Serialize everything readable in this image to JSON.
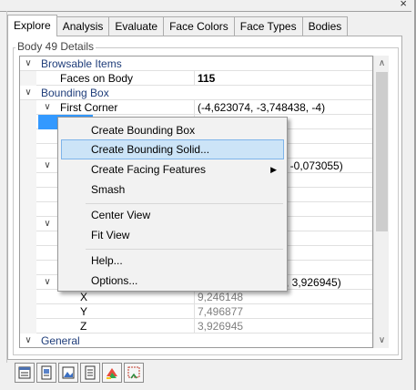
{
  "window": {
    "close_glyph": "×"
  },
  "tabs": [
    {
      "label": "Explore",
      "active": true
    },
    {
      "label": "Analysis"
    },
    {
      "label": "Evaluate"
    },
    {
      "label": "Face Colors"
    },
    {
      "label": "Face Types"
    },
    {
      "label": "Bodies"
    }
  ],
  "group": {
    "title": "Body 49 Details"
  },
  "grid": {
    "rows": {
      "browsable": {
        "label": "Browsable Items"
      },
      "faces": {
        "label": "Faces on Body",
        "value": "115"
      },
      "bbox": {
        "label": "Bounding Box"
      },
      "first_corner": {
        "label": "First Corner",
        "value": "(-4,623074, -3,748438, -4)"
      },
      "partial1": {
        "value": ", -0,073055)"
      },
      "partial2": {
        "value": ", 3,926945)"
      },
      "x": {
        "label": "X",
        "value": "9,246148"
      },
      "y": {
        "label": "Y",
        "value": "7,496877"
      },
      "z": {
        "label": "Z",
        "value": "3,926945"
      },
      "general": {
        "label": "General"
      }
    }
  },
  "context_menu": {
    "items": [
      {
        "label": "Create Bounding Box"
      },
      {
        "label": "Create Bounding Solid...",
        "highlighted": true
      },
      {
        "label": "Create Facing Features",
        "submenu": true
      },
      {
        "label": "Smash"
      },
      {
        "label": "Center View"
      },
      {
        "label": "Fit View"
      },
      {
        "label": "Help..."
      },
      {
        "label": "Options..."
      }
    ]
  },
  "icons": {
    "expand": "chevron-down-icon",
    "submenu": "chevron-right-icon",
    "scroll_up": "scroll-up-arrow-icon",
    "scroll_down": "scroll-down-arrow-icon"
  },
  "colors": {
    "selection": "#3399ff",
    "menu_highlight": "#cce4f7",
    "category_text": "#1f3d7a"
  }
}
